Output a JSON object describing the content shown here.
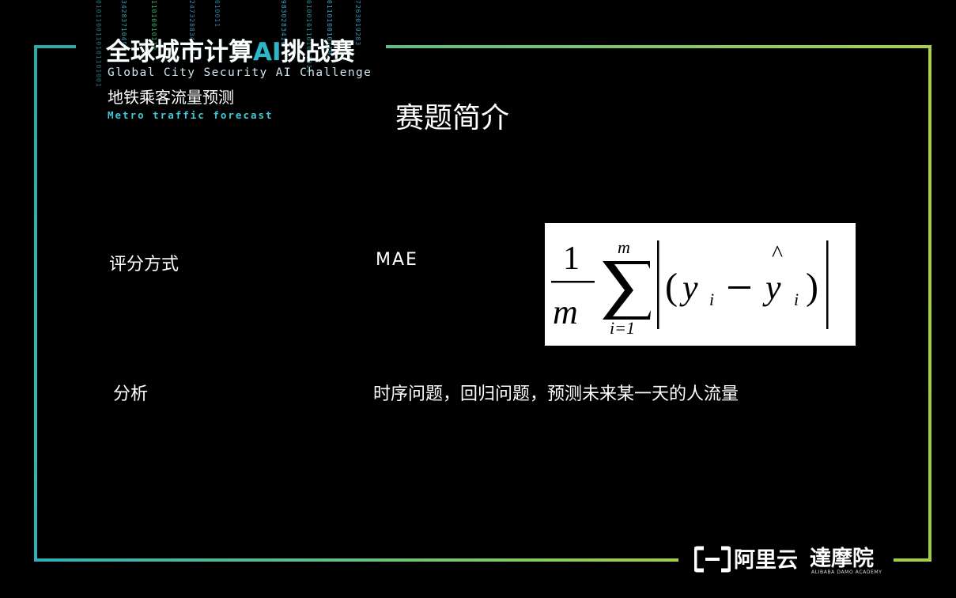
{
  "header": {
    "title_part1": "全球城市计算",
    "title_ai": "AI",
    "title_part2": "挑战赛",
    "subtitle_en": "Global City Security AI Challenge",
    "subtitle_cn": "地铁乘客流量预测",
    "subtitle_en2": "Metro traffic forecast"
  },
  "slide": {
    "title": "赛题简介",
    "rows": [
      {
        "label": "评分方式",
        "value": "MAE"
      },
      {
        "label": "分析",
        "value": "时序问题，回归问题，预测未来某一天的人流量"
      }
    ]
  },
  "formula": {
    "numerator": "1",
    "denominator": "m",
    "sum_upper": "m",
    "sum_lower": "i=1",
    "y": "y",
    "sub_i": "i",
    "hat": "^"
  },
  "footer": {
    "aliyun": "阿里云",
    "damo": "達摩院",
    "damo_sub": "ALIBABA DAMO ACADEMY"
  },
  "colors": {
    "background": "#000000",
    "frame_teal": "#2aa9a7",
    "frame_green": "#a8d04a",
    "accent_cyan": "#3ec9d6"
  }
}
